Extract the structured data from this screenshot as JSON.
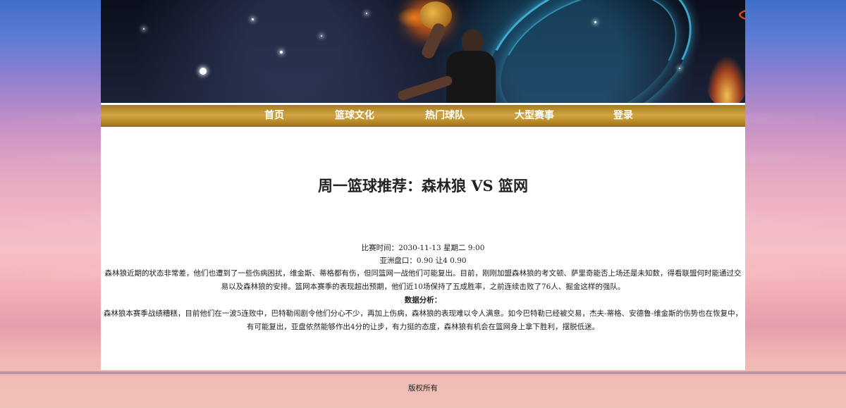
{
  "nav": {
    "items": [
      {
        "label": "首页"
      },
      {
        "label": "篮球文化"
      },
      {
        "label": "热门球队"
      },
      {
        "label": "大型赛事"
      },
      {
        "label": "登录"
      }
    ]
  },
  "article": {
    "title": "周一篮球推荐：森林狼 VS 篮网",
    "match_time": "比赛时间：2030-11-13 星期二 9:00",
    "handicap": "亚洲盘口：0.90 让4 0.90",
    "intro": "森林狼近期的状态非常差，他们也遭到了一些伤病困扰，维金斯、蒂格都有伤，但同篮网一战他们可能复出。目前，刚刚加盟森林狼的考文顿、萨里奇能否上场还是未知数，得看联盟何时能通过交易以及森林狼的安排。篮网本赛季的表现超出预期，他们近10场保持了五成胜率，之前连续击败了76人、掘金这样的强队。",
    "analysis_heading": "数据分析：",
    "analysis": "森林狼本赛季战绩糟糕，目前他们在一波5连败中，巴特勒闹剧令他们分心不少，再加上伤病，森林狼的表现难以令人满意。如今巴特勒已经被交易，杰夫-蒂格、安德鲁-维金斯的伤势也在恢复中，有可能复出，亚盘依然能够作出4分的让步，有力挺的态度，森林狼有机会在篮网身上拿下胜利，摆脱低迷。"
  },
  "footer": {
    "text": "版权所有"
  },
  "icons": {
    "banner": "basketball-dunk-banner"
  },
  "colors": {
    "nav_gold": "#c89a35",
    "content_bg": "#ffffff"
  }
}
